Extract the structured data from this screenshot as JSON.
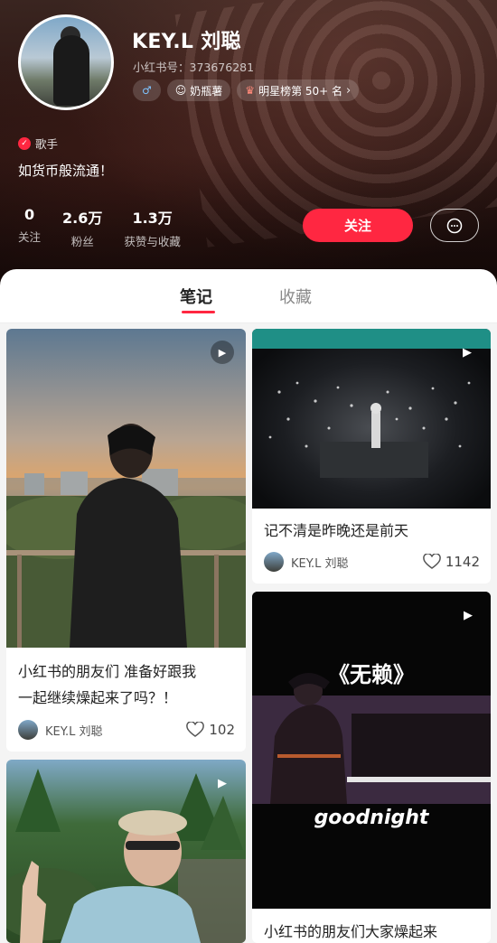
{
  "profile": {
    "name": "KEY.L 刘聪",
    "id_label": "小红书号：373676281",
    "tags": {
      "gender": "♂",
      "level": "奶瓶薯",
      "ranking": "明星榜第 50+ 名"
    },
    "verification": "歌手",
    "bio": "如货币般流通！",
    "stats": [
      {
        "num": "0",
        "label": "关注"
      },
      {
        "num": "2.6万",
        "label": "粉丝"
      },
      {
        "num": "1.3万",
        "label": "获赞与收藏"
      }
    ],
    "follow_label": "关注"
  },
  "tabs": [
    {
      "label": "笔记",
      "active": true
    },
    {
      "label": "收藏",
      "active": false
    }
  ],
  "notes": [
    {
      "title_lines": [
        "小红书的朋友们 准备好跟我",
        "一起继续燥起来了吗？！"
      ],
      "author": "KEY.L 刘聪",
      "likes": "102"
    },
    {
      "title_lines": [
        "记不清是昨晚还是前天"
      ],
      "author": "KEY.L 刘聪",
      "likes": "1142"
    },
    {
      "overlay_title": "《无赖》",
      "overlay_sub": "goodnight",
      "title_lines": [
        "小红书的朋友们大家燥起来"
      ]
    },
    {}
  ],
  "icons": {
    "play": "▶",
    "heart": "heart-outline",
    "message": "chat-bubble"
  },
  "colors": {
    "accent": "#ff2741",
    "header_bg": "#2a1512"
  }
}
